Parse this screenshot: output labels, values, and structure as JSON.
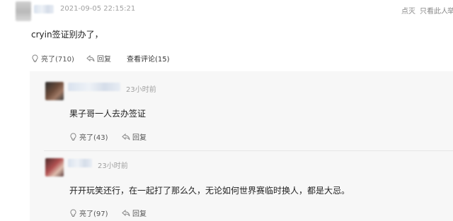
{
  "main_comment": {
    "timestamp": "2021-09-05 22:15:21",
    "text": "cryin签证别办了，",
    "actions": {
      "like": "亮了(710)",
      "reply": "回复",
      "view_replies": "查看评论(15)"
    },
    "top_actions": {
      "report": "点灭",
      "only_author": "只看此人",
      "more": "举"
    }
  },
  "replies": [
    {
      "time_ago": "23小时前",
      "text": "果子哥一人去办签证",
      "like": "亮了(43)",
      "reply": "回复"
    },
    {
      "time_ago": "23小时前",
      "text": "开开玩笑还行，在一起打了那么久，无论如何世界赛临时换人，都是大忌。",
      "like": "亮了(97)",
      "reply": "回复"
    }
  ],
  "colors": {
    "panel_bg": "#f7f7f7",
    "muted_text": "#a0a0a0"
  }
}
